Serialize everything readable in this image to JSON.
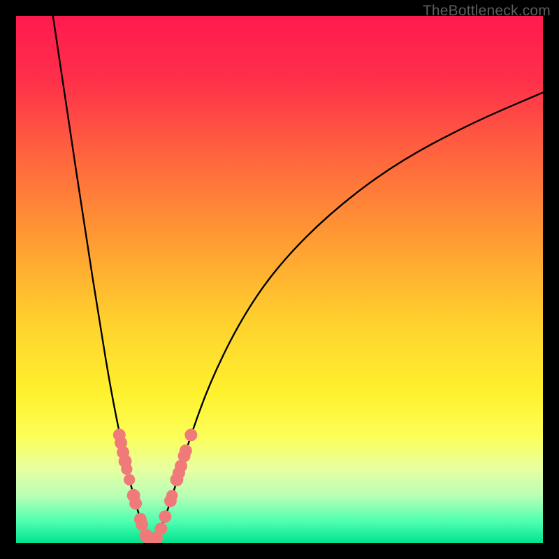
{
  "watermark": "TheBottleneck.com",
  "chart_data": {
    "type": "line",
    "title": "",
    "xlabel": "",
    "ylabel": "",
    "xlim": [
      0,
      100
    ],
    "ylim": [
      0,
      100
    ],
    "background_gradient": {
      "stops": [
        {
          "pos": 0.0,
          "color": "#ff1a4e"
        },
        {
          "pos": 0.12,
          "color": "#ff2f4a"
        },
        {
          "pos": 0.28,
          "color": "#ff6a3d"
        },
        {
          "pos": 0.42,
          "color": "#ff9a33"
        },
        {
          "pos": 0.58,
          "color": "#ffd12d"
        },
        {
          "pos": 0.72,
          "color": "#fff22f"
        },
        {
          "pos": 0.8,
          "color": "#fcff5a"
        },
        {
          "pos": 0.86,
          "color": "#e8ffa2"
        },
        {
          "pos": 0.91,
          "color": "#b8ffb4"
        },
        {
          "pos": 0.96,
          "color": "#4dffb0"
        },
        {
          "pos": 1.0,
          "color": "#00e38f"
        }
      ]
    },
    "series": [
      {
        "name": "left-curve",
        "x": [
          7.0,
          10.0,
          13.0,
          16.0,
          18.0,
          20.0,
          21.5,
          23.0,
          24.0,
          25.0
        ],
        "y": [
          100.0,
          80.0,
          60.0,
          41.0,
          29.0,
          19.0,
          12.0,
          6.5,
          3.0,
          0.8
        ]
      },
      {
        "name": "right-curve",
        "x": [
          26.5,
          28.0,
          30.0,
          33.0,
          37.0,
          43.0,
          50.0,
          60.0,
          72.0,
          86.0,
          100.0
        ],
        "y": [
          0.8,
          4.0,
          10.0,
          20.0,
          31.0,
          43.0,
          53.0,
          63.0,
          72.0,
          79.5,
          85.5
        ]
      },
      {
        "name": "valley-floor",
        "x": [
          25.0,
          25.7,
          26.5
        ],
        "y": [
          0.8,
          0.3,
          0.8
        ]
      }
    ],
    "markers": [
      {
        "x": 19.6,
        "y": 20.5,
        "r": 1.2
      },
      {
        "x": 19.9,
        "y": 19.0,
        "r": 1.2
      },
      {
        "x": 20.3,
        "y": 17.2,
        "r": 1.2
      },
      {
        "x": 20.7,
        "y": 15.5,
        "r": 1.3
      },
      {
        "x": 21.0,
        "y": 14.0,
        "r": 1.0
      },
      {
        "x": 21.5,
        "y": 12.0,
        "r": 1.0
      },
      {
        "x": 22.3,
        "y": 9.0,
        "r": 1.3
      },
      {
        "x": 22.7,
        "y": 7.5,
        "r": 1.2
      },
      {
        "x": 23.6,
        "y": 4.5,
        "r": 1.2
      },
      {
        "x": 23.9,
        "y": 3.5,
        "r": 1.2
      },
      {
        "x": 24.7,
        "y": 1.4,
        "r": 1.3
      },
      {
        "x": 25.4,
        "y": 0.5,
        "r": 1.2
      },
      {
        "x": 26.0,
        "y": 0.5,
        "r": 1.2
      },
      {
        "x": 26.6,
        "y": 0.9,
        "r": 1.3
      },
      {
        "x": 27.5,
        "y": 2.7,
        "r": 1.2
      },
      {
        "x": 28.3,
        "y": 5.0,
        "r": 1.2
      },
      {
        "x": 29.3,
        "y": 8.0,
        "r": 1.2
      },
      {
        "x": 29.6,
        "y": 9.0,
        "r": 1.0
      },
      {
        "x": 30.5,
        "y": 12.0,
        "r": 1.3
      },
      {
        "x": 30.9,
        "y": 13.3,
        "r": 1.2
      },
      {
        "x": 31.3,
        "y": 14.6,
        "r": 1.2
      },
      {
        "x": 31.9,
        "y": 16.5,
        "r": 1.2
      },
      {
        "x": 32.2,
        "y": 17.5,
        "r": 1.2
      },
      {
        "x": 33.2,
        "y": 20.5,
        "r": 1.2
      }
    ],
    "marker_color": "#f07a7a",
    "curve_color": "#000000"
  }
}
